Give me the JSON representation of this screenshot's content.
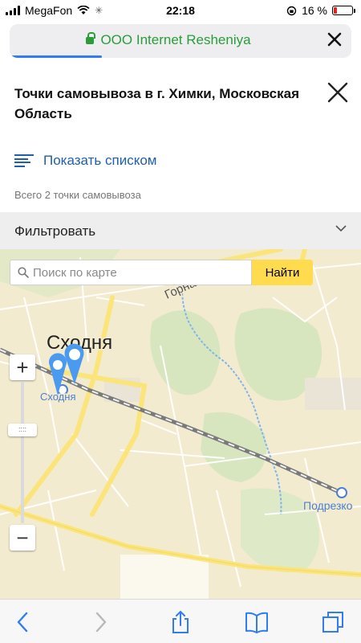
{
  "status_bar": {
    "carrier": "MegaFon",
    "time": "22:18",
    "battery": "16 %",
    "battery_level": 0.16
  },
  "browser": {
    "url": "ООО Internet Resheniya",
    "load_progress": 0.27
  },
  "panel": {
    "title": "Точки самовывоза в г. Химки, Московская Область",
    "show_list_label": "Показать списком",
    "total_label": "Всего 2 точки самовывоза",
    "filter_label": "Фильтровать"
  },
  "map": {
    "search_placeholder": "Поиск по карте",
    "find_label": "Найти",
    "labels": {
      "district": "Сходня",
      "station_1": "Сходня",
      "station_2": "Подрезко",
      "street": "Горная"
    },
    "zoom_in": "+",
    "zoom_out": "−",
    "zoom_handle": "::::",
    "colors": {
      "route": "#7a7a7a",
      "major_road": "#fbe57a",
      "park": "#d8e6c0",
      "pin": "#4a9af0"
    }
  },
  "toolbar": {
    "icons": [
      "back-icon",
      "forward-icon",
      "share-icon",
      "bookmarks-icon",
      "tabs-icon"
    ]
  }
}
